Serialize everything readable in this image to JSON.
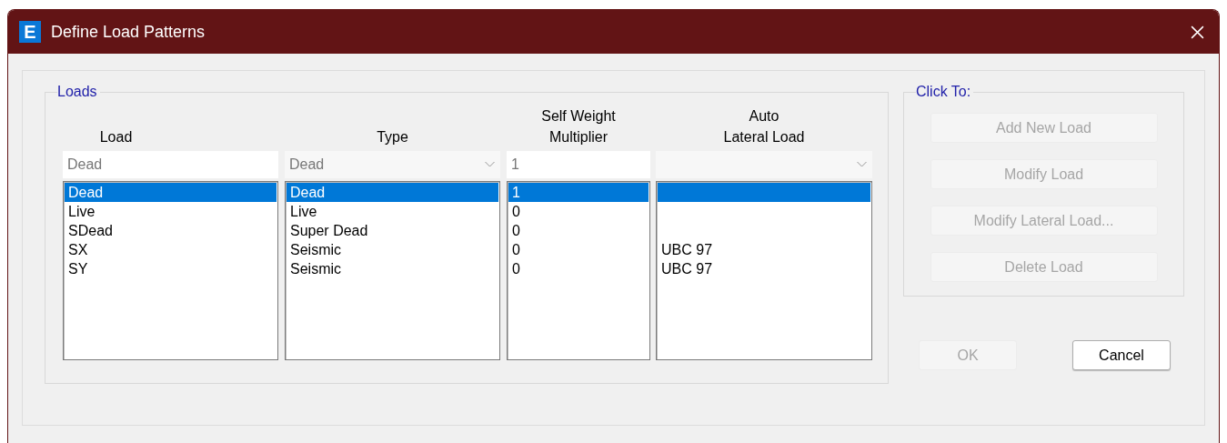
{
  "window": {
    "title": "Define Load Patterns",
    "app_icon": "E"
  },
  "loads": {
    "title": "Loads",
    "columns": [
      {
        "heading": "Load",
        "kind": "text",
        "value": "Dead"
      },
      {
        "heading": "Type",
        "kind": "dropdown",
        "value": "Dead"
      },
      {
        "heading": "Self Weight\nMultiplier",
        "kind": "text",
        "value": "1"
      },
      {
        "heading": "Auto\nLateral Load",
        "kind": "dropdown"
      }
    ],
    "rows": [
      {
        "cells": [
          "Dead",
          "Dead",
          "1"
        ],
        "selected": true
      },
      {
        "cells": [
          "Live",
          "Live",
          "0"
        ],
        "selected": false
      },
      {
        "cells": [
          "SDead",
          "Super Dead",
          "0"
        ],
        "selected": false
      },
      {
        "cells": [
          "SX",
          "Seismic",
          "0",
          "UBC 97"
        ],
        "selected": false
      },
      {
        "cells": [
          "SY",
          "Seismic",
          "0",
          "UBC 97"
        ],
        "selected": false
      }
    ]
  },
  "click_to": {
    "title": "Click To:",
    "buttons": [
      {
        "label": "Add New Load",
        "disabled": true
      },
      {
        "label": "Modify Load",
        "disabled": true
      },
      {
        "label": "Modify Lateral Load...",
        "disabled": true
      },
      {
        "label": "Delete Load",
        "disabled": true
      }
    ]
  },
  "footer_buttons": [
    {
      "label": "OK",
      "disabled": true
    },
    {
      "label": "Cancel",
      "disabled": false
    }
  ]
}
